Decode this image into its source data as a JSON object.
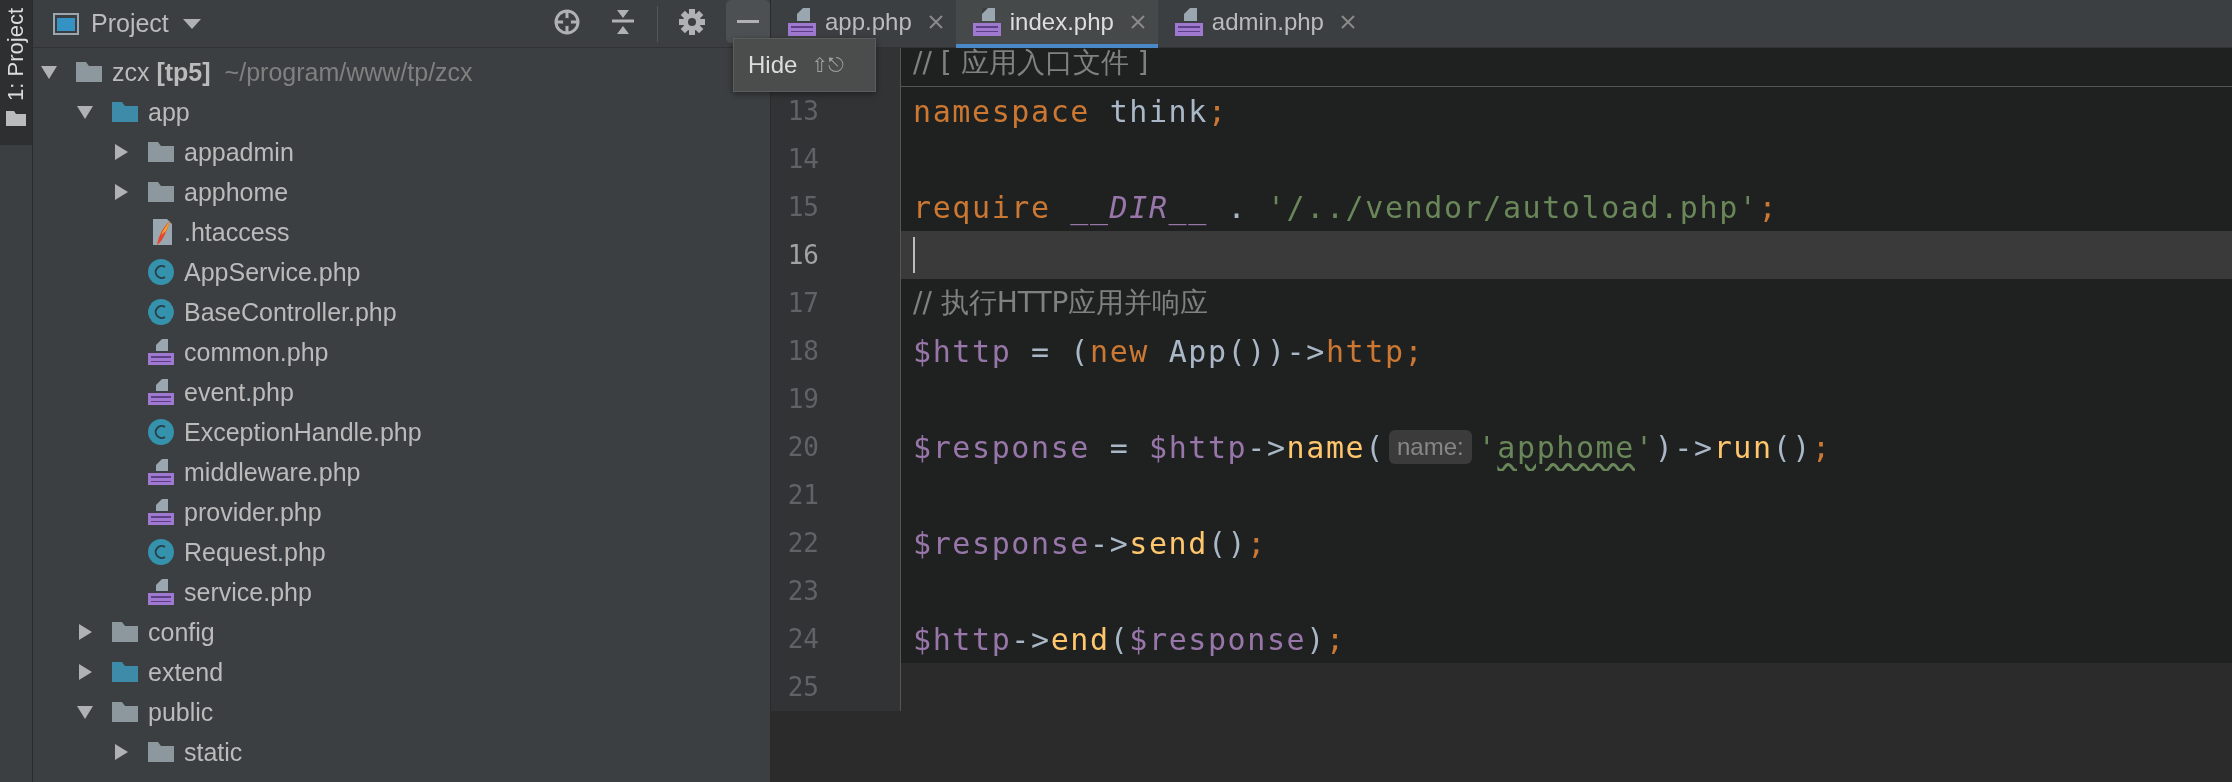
{
  "tool_stripe": {
    "tabs": [
      {
        "label": "1: Project",
        "selected": true
      }
    ]
  },
  "project_panel": {
    "title": "Project",
    "header_buttons": [
      {
        "kind": "locate",
        "hovered": false
      },
      {
        "kind": "collapse",
        "hovered": false
      },
      {
        "kind": "settings",
        "hovered": false
      },
      {
        "kind": "hide",
        "hovered": true
      }
    ],
    "tree": [
      {
        "label": "zcx **[tp5]**",
        "location": "~/program/www/tp/zcx",
        "kind": "folder",
        "expanded": true,
        "children": [
          {
            "label": "app",
            "kind": "source_folder",
            "expanded": true,
            "children": [
              {
                "label": "appadmin",
                "kind": "folder",
                "expanded": false
              },
              {
                "label": "apphome",
                "kind": "folder",
                "expanded": false
              },
              {
                "label": ".htaccess",
                "kind": "htaccess"
              },
              {
                "label": "AppService.php",
                "kind": "class"
              },
              {
                "label": "BaseController.php",
                "kind": "abstract_class"
              },
              {
                "label": "common.php",
                "kind": "php"
              },
              {
                "label": "event.php",
                "kind": "php"
              },
              {
                "label": "ExceptionHandle.php",
                "kind": "class"
              },
              {
                "label": "middleware.php",
                "kind": "php"
              },
              {
                "label": "provider.php",
                "kind": "php"
              },
              {
                "label": "Request.php",
                "kind": "class"
              },
              {
                "label": "service.php",
                "kind": "php"
              }
            ]
          },
          {
            "label": "config",
            "kind": "folder",
            "expanded": false
          },
          {
            "label": "extend",
            "kind": "source_folder",
            "expanded": false
          },
          {
            "label": "public",
            "kind": "folder",
            "expanded": true,
            "children": [
              {
                "label": "static",
                "kind": "folder",
                "expanded": false
              }
            ]
          }
        ]
      }
    ]
  },
  "tooltip": {
    "label": "Hide",
    "shortcut": "⇧⎋"
  },
  "editor": {
    "tabs": [
      {
        "label": "app.php",
        "selected": false
      },
      {
        "label": "index.php",
        "selected": true
      },
      {
        "label": "admin.php",
        "selected": false
      }
    ],
    "lines": [
      {
        "in_block": true,
        "current": false,
        "separator_below": true,
        "tokens": [
          {
            "kind": "comment",
            "text": "// [ 应用入口文件 ]"
          }
        ]
      },
      {
        "number": "13",
        "in_block": true,
        "current": false,
        "tokens": [
          {
            "kind": "keyword",
            "text": "namespace"
          },
          {
            "kind": "plain",
            "text": " think"
          },
          {
            "kind": "keyword",
            "text": ";"
          }
        ]
      },
      {
        "number": "14",
        "in_block": true,
        "current": false
      },
      {
        "number": "15",
        "in_block": true,
        "current": false,
        "tokens": [
          {
            "kind": "keyword",
            "text": "require "
          },
          {
            "kind": "constant",
            "text": "__DIR__"
          },
          {
            "kind": "plain",
            "text": " . "
          },
          {
            "kind": "string",
            "text": "'/../vendor/autoload.php'"
          },
          {
            "kind": "keyword",
            "text": ";"
          }
        ]
      },
      {
        "number": "16",
        "in_block": true,
        "current": true
      },
      {
        "number": "17",
        "in_block": true,
        "current": false,
        "tokens": [
          {
            "kind": "comment",
            "text": "// 执行HTTP应用并响应"
          }
        ]
      },
      {
        "number": "18",
        "in_block": true,
        "current": false,
        "tokens": [
          {
            "kind": "variable",
            "text": "$http"
          },
          {
            "kind": "plain",
            "text": " = ("
          },
          {
            "kind": "keyword",
            "text": "new"
          },
          {
            "kind": "plain",
            "text": " App())->"
          },
          {
            "kind": "property",
            "text": "http"
          },
          {
            "kind": "keyword",
            "text": ";"
          }
        ]
      },
      {
        "number": "19",
        "in_block": true,
        "current": false
      },
      {
        "number": "20",
        "in_block": true,
        "current": false,
        "tokens": [
          {
            "kind": "variable",
            "text": "$response"
          },
          {
            "kind": "plain",
            "text": " = "
          },
          {
            "kind": "variable",
            "text": "$http"
          },
          {
            "kind": "plain",
            "text": "->"
          },
          {
            "kind": "function",
            "text": "name"
          },
          {
            "kind": "plain",
            "text": "("
          },
          {
            "kind": "hint",
            "text": "name:"
          },
          {
            "kind": "string",
            "text": "'"
          },
          {
            "kind": "typo",
            "text": "apphome"
          },
          {
            "kind": "string",
            "text": "'"
          },
          {
            "kind": "plain",
            "text": ")->"
          },
          {
            "kind": "function",
            "text": "run"
          },
          {
            "kind": "plain",
            "text": "()"
          },
          {
            "kind": "keyword",
            "text": ";"
          }
        ]
      },
      {
        "number": "21",
        "in_block": true,
        "current": false
      },
      {
        "number": "22",
        "in_block": true,
        "current": false,
        "tokens": [
          {
            "kind": "variable",
            "text": "$response"
          },
          {
            "kind": "plain",
            "text": "->"
          },
          {
            "kind": "function",
            "text": "send"
          },
          {
            "kind": "plain",
            "text": "()"
          },
          {
            "kind": "keyword",
            "text": ";"
          }
        ]
      },
      {
        "number": "23",
        "in_block": true,
        "current": false
      },
      {
        "number": "24",
        "in_block": true,
        "current": false,
        "tokens": [
          {
            "kind": "variable",
            "text": "$http"
          },
          {
            "kind": "plain",
            "text": "->"
          },
          {
            "kind": "function",
            "text": "end"
          },
          {
            "kind": "plain",
            "text": "("
          },
          {
            "kind": "variable",
            "text": "$response"
          },
          {
            "kind": "plain",
            "text": ")"
          },
          {
            "kind": "keyword",
            "text": ";"
          }
        ]
      },
      {
        "number": "25"
      }
    ]
  }
}
